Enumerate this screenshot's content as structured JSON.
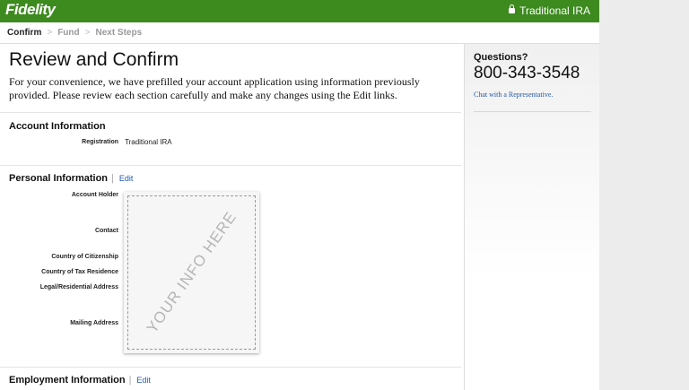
{
  "header": {
    "logo": "Fidelity",
    "account_type": "Traditional IRA",
    "lock_icon": "lock-icon"
  },
  "breadcrumb": {
    "steps": [
      "Confirm",
      "Fund",
      "Next Steps"
    ],
    "active_index": 0,
    "separator": ">"
  },
  "main": {
    "title": "Review and Confirm",
    "intro": "For your convenience, we have prefilled your account application using information previously provided. Please review each section carefully and make any changes using the Edit links.",
    "account_information": {
      "title": "Account Information",
      "registration_label": "Registration",
      "registration_value": "Traditional IRA"
    },
    "personal_information": {
      "title": "Personal Information",
      "edit_label": "Edit",
      "labels": {
        "account_holder": "Account Holder",
        "contact": "Contact",
        "citizenship": "Country of Citizenship",
        "tax_residence": "Country of Tax Residence",
        "legal_address": "Legal/Residential Address",
        "mailing_address": "Mailing Address"
      },
      "placeholder_text": "YOUR INFO HERE"
    },
    "employment_information": {
      "title": "Employment Information",
      "edit_label": "Edit"
    }
  },
  "sidebar": {
    "title": "Questions?",
    "phone": "800-343-3548",
    "chat_link": "Chat with a Representative."
  },
  "colors": {
    "brand_green": "#3d8a1f",
    "link_blue": "#2459a8"
  }
}
